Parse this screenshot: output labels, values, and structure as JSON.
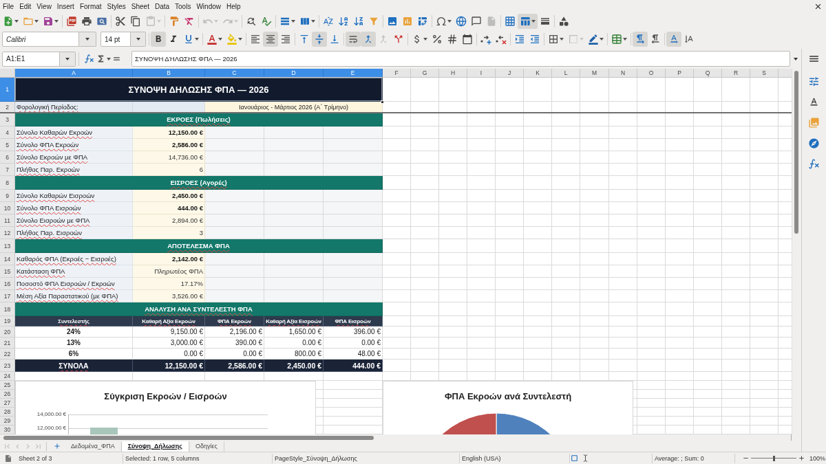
{
  "menu_bar": {
    "items": [
      "File",
      "Edit",
      "View",
      "Insert",
      "Format",
      "Styles",
      "Sheet",
      "Data",
      "Tools",
      "Window",
      "Help"
    ]
  },
  "standard_toolbar": [
    {
      "pressed": false,
      "disabled": false
    },
    {
      "pressed": false,
      "disabled": false
    },
    {
      "pressed": false,
      "disabled": false
    },
    {
      "pressed": false,
      "disabled": false
    },
    {
      "pressed": false,
      "disabled": false
    },
    {
      "pressed": false,
      "disabled": false
    },
    {
      "pressed": false,
      "disabled": false
    },
    {
      "pressed": false,
      "disabled": false
    },
    {
      "pressed": false,
      "disabled": true
    },
    {
      "pressed": false,
      "disabled": false
    },
    {
      "pressed": false,
      "disabled": false
    },
    {
      "pressed": false,
      "disabled": true
    },
    {
      "pressed": false,
      "disabled": true
    },
    {
      "pressed": false,
      "disabled": false
    },
    {
      "pressed": false,
      "disabled": false
    },
    {
      "pressed": false,
      "disabled": false
    },
    {
      "pressed": false,
      "disabled": false
    },
    {
      "pressed": false,
      "disabled": false
    },
    {
      "pressed": false,
      "disabled": false
    },
    {
      "pressed": false,
      "disabled": false
    },
    {
      "pressed": false,
      "disabled": false
    },
    {
      "pressed": false,
      "disabled": false
    },
    {
      "pressed": false,
      "disabled": false
    },
    {
      "pressed": false,
      "disabled": false
    },
    {
      "pressed": false,
      "disabled": false
    },
    {
      "pressed": false,
      "disabled": false
    },
    {
      "pressed": false,
      "disabled": false
    },
    {
      "pressed": false,
      "disabled": true
    },
    {
      "pressed": false,
      "disabled": false
    },
    {
      "pressed": true,
      "disabled": false
    },
    {
      "pressed": false,
      "disabled": false
    },
    {
      "pressed": false,
      "disabled": false
    }
  ],
  "formatting_toolbar": {
    "font_name": "Calibri",
    "font_size": "14 pt",
    "buttons": [
      {
        "pressed": true,
        "disabled": false
      },
      {
        "pressed": false,
        "disabled": false
      },
      {
        "pressed": false,
        "disabled": false
      },
      {
        "pressed": false,
        "disabled": false
      },
      {
        "pressed": false,
        "disabled": false
      },
      {
        "pressed": false,
        "disabled": false
      },
      {
        "pressed": true,
        "disabled": false
      },
      {
        "pressed": false,
        "disabled": false
      },
      {
        "pressed": false,
        "disabled": false
      },
      {
        "pressed": true,
        "disabled": false
      },
      {
        "pressed": false,
        "disabled": false
      },
      {
        "pressed": true,
        "disabled": false
      },
      {
        "pressed": true,
        "disabled": false
      },
      {
        "pressed": false,
        "disabled": true
      },
      {
        "pressed": false,
        "disabled": false
      },
      {
        "pressed": false,
        "disabled": false
      },
      {
        "pressed": false,
        "disabled": false
      },
      {
        "pressed": false,
        "disabled": false
      },
      {
        "pressed": false,
        "disabled": false
      },
      {
        "pressed": false,
        "disabled": false
      },
      {
        "pressed": false,
        "disabled": false
      },
      {
        "pressed": false,
        "disabled": false
      },
      {
        "pressed": false,
        "disabled": false
      },
      {
        "pressed": false,
        "disabled": false
      },
      {
        "pressed": false,
        "disabled": true
      },
      {
        "pressed": false,
        "disabled": false
      },
      {
        "pressed": false,
        "disabled": false
      },
      {
        "pressed": true,
        "disabled": false
      },
      {
        "pressed": false,
        "disabled": false
      },
      {
        "pressed": true,
        "disabled": false
      },
      {
        "pressed": false,
        "disabled": false
      }
    ]
  },
  "formula_bar": {
    "name_box": "A1:E1",
    "formula": "ΣΥΝΟΨΗ ΔΉΛΩΣΗΣ ΦΠΑ — 2026"
  },
  "sheet": {
    "columns": [
      {
        "label": "A",
        "selected": true
      },
      {
        "label": "B",
        "selected": true
      },
      {
        "label": "C",
        "selected": true
      },
      {
        "label": "D",
        "selected": true
      },
      {
        "label": "E",
        "selected": true
      },
      {
        "label": "F",
        "selected": false
      },
      {
        "label": "G",
        "selected": false
      },
      {
        "label": "H",
        "selected": false
      },
      {
        "label": "I",
        "selected": false
      },
      {
        "label": "J",
        "selected": false
      },
      {
        "label": "K",
        "selected": false
      },
      {
        "label": "L",
        "selected": false
      },
      {
        "label": "M",
        "selected": false
      },
      {
        "label": "N",
        "selected": false
      },
      {
        "label": "O",
        "selected": false
      },
      {
        "label": "P",
        "selected": false
      },
      {
        "label": "Q",
        "selected": false
      },
      {
        "label": "R",
        "selected": false
      },
      {
        "label": "S",
        "selected": false
      }
    ],
    "rows": [
      {
        "number": "1",
        "selected": true,
        "freeze_line_below": false,
        "kind": "title",
        "text": "ΣΥΝΟΨΗ ΔΗΛΩΣΗΣ ΦΠΑ — 2026"
      },
      {
        "number": "2",
        "selected": false,
        "freeze_line_below": true,
        "kind": "period",
        "label": "Φορολογική Περίοδος:",
        "period": "Ιανουάριος - Μάρτιος 2026 (Α΄ Τρίμηνο)"
      },
      {
        "number": "3",
        "selected": false,
        "freeze_line_below": false,
        "kind": "section",
        "text": "ΕΚΡΟΕΣ (Πωλήσεις)"
      },
      {
        "number": "4",
        "selected": false,
        "freeze_line_below": false,
        "kind": "item",
        "label": "Σύνολο Καθαρών Εκροών",
        "value": "12,150.00 €",
        "emphasized": true
      },
      {
        "number": "5",
        "selected": false,
        "freeze_line_below": false,
        "kind": "item",
        "label": "Σύνολο ΦΠΑ Εκροών",
        "value": "2,586.00 €",
        "emphasized": true
      },
      {
        "number": "6",
        "selected": false,
        "freeze_line_below": false,
        "kind": "item",
        "label": "Σύνολο Εκροών με ΦΠΑ",
        "value": "14,736.00 €",
        "emphasized": false
      },
      {
        "number": "7",
        "selected": false,
        "freeze_line_below": false,
        "kind": "item",
        "label": "Πλήθος Παρ. Εκροών",
        "value": "6",
        "emphasized": false
      },
      {
        "number": "8",
        "selected": false,
        "freeze_line_below": false,
        "kind": "section",
        "text": "ΕΙΣΡΟΕΣ (Αγορές)"
      },
      {
        "number": "9",
        "selected": false,
        "freeze_line_below": false,
        "kind": "item",
        "label": "Σύνολο Καθαρών Εισροών",
        "value": "2,450.00 €",
        "emphasized": true
      },
      {
        "number": "10",
        "selected": false,
        "freeze_line_below": false,
        "kind": "item",
        "label": "Σύνολο ΦΠΑ Εισροών",
        "value": "444.00 €",
        "emphasized": true
      },
      {
        "number": "11",
        "selected": false,
        "freeze_line_below": false,
        "kind": "item",
        "label": "Σύνολο Εισροών με ΦΠΑ",
        "value": "2,894.00 €",
        "emphasized": false
      },
      {
        "number": "12",
        "selected": false,
        "freeze_line_below": false,
        "kind": "item",
        "label": "Πλήθος Παρ. Εισροών",
        "value": "3",
        "emphasized": false
      },
      {
        "number": "13",
        "selected": false,
        "freeze_line_below": false,
        "kind": "section",
        "text": "ΑΠΟΤΕΛΕΣΜΑ ΦΠΑ"
      },
      {
        "number": "14",
        "selected": false,
        "freeze_line_below": false,
        "kind": "item",
        "label": "Καθαρός ΦΠΑ (Εκροές − Εισροές)",
        "value": "2,142.00 €",
        "emphasized": true
      },
      {
        "number": "15",
        "selected": false,
        "freeze_line_below": false,
        "kind": "item",
        "label": "Κατάσταση ΦΠΑ",
        "value": "Πληρωτέος ΦΠΑ",
        "emphasized": false
      },
      {
        "number": "16",
        "selected": false,
        "freeze_line_below": false,
        "kind": "item",
        "label": "Ποσοστό ΦΠΑ Εισροών / Εκροών",
        "value": "17.17%",
        "emphasized": false
      },
      {
        "number": "17",
        "selected": false,
        "freeze_line_below": false,
        "kind": "item",
        "label": "Μέση Αξία Παραστατικού (με ΦΠΑ)",
        "value": "3,526.00 €",
        "emphasized": false
      },
      {
        "number": "18",
        "selected": false,
        "freeze_line_below": false,
        "kind": "section",
        "text": "ΑΝΑΛΥΣΗ ΑΝΑ ΣΥΝΤΕΛΕΣΤΗ ΦΠΑ"
      },
      {
        "number": "19",
        "selected": false,
        "freeze_line_below": false,
        "kind": "table_header",
        "cells": [
          "Συντελεστής",
          "Καθαρή Αξία Εκροών",
          "ΦΠΑ Εκροών",
          "Καθαρή Αξία Εισροών",
          "ΦΠΑ Εισροών"
        ]
      },
      {
        "number": "20",
        "selected": false,
        "freeze_line_below": false,
        "kind": "rate",
        "cells": [
          "24%",
          "9,150.00 €",
          "2,196.00 €",
          "1,650.00 €",
          "396.00 €"
        ]
      },
      {
        "number": "21",
        "selected": false,
        "freeze_line_below": false,
        "kind": "rate",
        "cells": [
          "13%",
          "3,000.00 €",
          "390.00 €",
          "0.00 €",
          "0.00 €"
        ]
      },
      {
        "number": "22",
        "selected": false,
        "freeze_line_below": false,
        "kind": "rate",
        "cells": [
          "6%",
          "0.00 €",
          "0.00 €",
          "800.00 €",
          "48.00 €"
        ]
      },
      {
        "number": "23",
        "selected": false,
        "freeze_line_below": false,
        "kind": "total",
        "cells": [
          "ΣΥΝΟΛΑ",
          "12,150.00 €",
          "2,586.00 €",
          "2,450.00 €",
          "444.00 €"
        ]
      },
      {
        "number": "24",
        "selected": false,
        "freeze_line_below": false,
        "kind": "empty"
      },
      {
        "number": "25",
        "selected": false,
        "freeze_line_below": false,
        "kind": "empty"
      },
      {
        "number": "26",
        "selected": false,
        "freeze_line_below": false,
        "kind": "empty"
      },
      {
        "number": "27",
        "selected": false,
        "freeze_line_below": false,
        "kind": "empty"
      },
      {
        "number": "28",
        "selected": false,
        "freeze_line_below": false,
        "kind": "empty"
      },
      {
        "number": "29",
        "selected": false,
        "freeze_line_below": false,
        "kind": "empty"
      },
      {
        "number": "30",
        "selected": false,
        "freeze_line_below": false,
        "kind": "empty"
      }
    ],
    "charts": [
      {
        "kind": "bar",
        "title": "Σύγκριση Εκροών / Εισροών",
        "tick_labels": [
          "14,000.00 €",
          "12,000.00 €"
        ]
      },
      {
        "kind": "pie",
        "title": "ΦΠΑ Εκροών ανά Συντελεστή"
      }
    ]
  },
  "sheet_tabs": {
    "navigation": [
      {
        "disabled": true
      },
      {
        "disabled": true
      },
      {
        "disabled": true
      },
      {
        "disabled": true
      }
    ],
    "tabs": [
      {
        "label": "Δεδομένα_ΦΠΑ",
        "selected": false
      },
      {
        "label": "Σύνοψη_Δήλωσης",
        "selected": true
      },
      {
        "label": "Οδηγίες",
        "selected": false
      }
    ]
  },
  "status_bar": {
    "sheet": "Sheet 2 of 3",
    "selection": "Selected: 1 row, 5 columns",
    "page_style": "PageStyle_Σύνοψη_Δήλωσης",
    "language": "English (USA)",
    "summary": "Average: ; Sum: 0",
    "zoom": {
      "label": "100%",
      "level": 0.5
    }
  }
}
